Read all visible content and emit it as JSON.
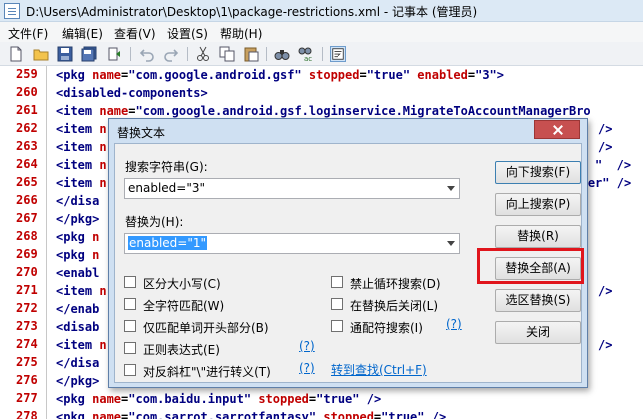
{
  "window": {
    "title": "D:\\Users\\Administrator\\Desktop\\1\\package-restrictions.xml - 记事本 (管理员)"
  },
  "menu": [
    "文件(F)",
    "编辑(E)",
    "查看(V)",
    "设置(S)",
    "帮助(H)"
  ],
  "toolbar": [
    "new-file-icon",
    "open-file-icon",
    "save-icon",
    "save-all-icon",
    "reload-icon",
    "undo-icon",
    "redo-icon",
    "cut-icon",
    "copy-icon",
    "paste-icon",
    "find-icon",
    "replace-icon",
    "word-wrap-icon"
  ],
  "lines": [
    {
      "no": "259",
      "parts": [
        [
          "t",
          "<pkg "
        ],
        [
          "a",
          "name"
        ],
        [
          "e",
          "="
        ],
        [
          "v",
          "\"com.google.android.gsf\""
        ],
        [
          "t",
          " "
        ],
        [
          "a",
          "stopped"
        ],
        [
          "e",
          "="
        ],
        [
          "v",
          "\"true\""
        ],
        [
          "t",
          " "
        ],
        [
          "a",
          "enabled"
        ],
        [
          "e",
          "="
        ],
        [
          "v",
          "\"3\""
        ],
        [
          "t",
          ">"
        ]
      ]
    },
    {
      "no": "260",
      "parts": [
        [
          "t",
          "<disabled-components>"
        ]
      ]
    },
    {
      "no": "261",
      "parts": [
        [
          "t",
          "<item "
        ],
        [
          "a",
          "name"
        ],
        [
          "e",
          "="
        ],
        [
          "v",
          "\"com.google.android.gsf.loginservice.MigrateToAccountManagerBro"
        ]
      ]
    },
    {
      "no": "262",
      "parts": [
        [
          "t",
          "<item "
        ],
        [
          "a",
          "n"
        ]
      ],
      "tail": "/>"
    },
    {
      "no": "263",
      "parts": [
        [
          "t",
          "<item "
        ],
        [
          "a",
          "n"
        ]
      ],
      "tail": "/>"
    },
    {
      "no": "264",
      "parts": [
        [
          "t",
          "<item "
        ],
        [
          "a",
          "n"
        ]
      ],
      "tail": "\"  />"
    },
    {
      "no": "265",
      "parts": [
        [
          "t",
          "<item "
        ],
        [
          "a",
          "n"
        ]
      ],
      "tail": "ver\" />"
    },
    {
      "no": "266",
      "parts": [
        [
          "t",
          "</disa"
        ]
      ]
    },
    {
      "no": "267",
      "parts": [
        [
          "t",
          "</pkg>"
        ]
      ]
    },
    {
      "no": "268",
      "parts": [
        [
          "t",
          "<pkg "
        ],
        [
          "a",
          "n"
        ]
      ]
    },
    {
      "no": "269",
      "parts": [
        [
          "t",
          "<pkg "
        ],
        [
          "a",
          "n"
        ]
      ]
    },
    {
      "no": "270",
      "parts": [
        [
          "t",
          "<enabl"
        ]
      ]
    },
    {
      "no": "271",
      "parts": [
        [
          "t",
          "<item "
        ],
        [
          "a",
          "n"
        ]
      ],
      "tail": "/>"
    },
    {
      "no": "272",
      "parts": [
        [
          "t",
          "</enab"
        ]
      ]
    },
    {
      "no": "273",
      "parts": [
        [
          "t",
          "<disab"
        ]
      ]
    },
    {
      "no": "274",
      "parts": [
        [
          "t",
          "<item "
        ],
        [
          "a",
          "n"
        ]
      ],
      "tail": "/>"
    },
    {
      "no": "275",
      "parts": [
        [
          "t",
          "</disa"
        ]
      ]
    },
    {
      "no": "276",
      "parts": [
        [
          "t",
          "</pkg>"
        ]
      ]
    },
    {
      "no": "277",
      "parts": [
        [
          "t",
          "<pkg "
        ],
        [
          "a",
          "name"
        ],
        [
          "e",
          "="
        ],
        [
          "v",
          "\"com.baidu.input\""
        ],
        [
          "t",
          " "
        ],
        [
          "a",
          "stopped"
        ],
        [
          "e",
          "="
        ],
        [
          "v",
          "\"true\""
        ],
        [
          "t",
          " />"
        ]
      ]
    },
    {
      "no": "278",
      "parts": [
        [
          "t",
          "<pkg "
        ],
        [
          "a",
          "name"
        ],
        [
          "e",
          "="
        ],
        [
          "v",
          "\"com.sarrot.sarrotfantasy\""
        ],
        [
          "t",
          " "
        ],
        [
          "a",
          "stopped"
        ],
        [
          "e",
          "="
        ],
        [
          "v",
          "\"true\""
        ],
        [
          "t",
          " />"
        ]
      ]
    }
  ],
  "dialog": {
    "title": "替换文本",
    "search_label": "搜索字符串(G):",
    "search_value": "enabled=\"3\"",
    "replace_label": "替换为(H):",
    "replace_value": "enabled=\"1\"",
    "options_left": [
      "区分大小写(C)",
      "全字符匹配(W)",
      "仅匹配单词开头部分(B)",
      "正则表达式(E)",
      "对反斜杠\"\\\"进行转义(T)"
    ],
    "options_right": [
      "禁止循环搜索(D)",
      "在替换后关闭(L)",
      "通配符搜索(I)"
    ],
    "help": "(?)",
    "goto_link": "转到查找(Ctrl+F)",
    "buttons": [
      "向下搜索(F)",
      "向上搜索(P)",
      "替换(R)",
      "替换全部(A)",
      "选区替换(S)",
      "关闭"
    ]
  },
  "colors": {
    "line_number": "#c00000",
    "tag": "#000080",
    "attr": "#c00000",
    "highlight": "#e0151c",
    "selection": "#3399ff"
  }
}
